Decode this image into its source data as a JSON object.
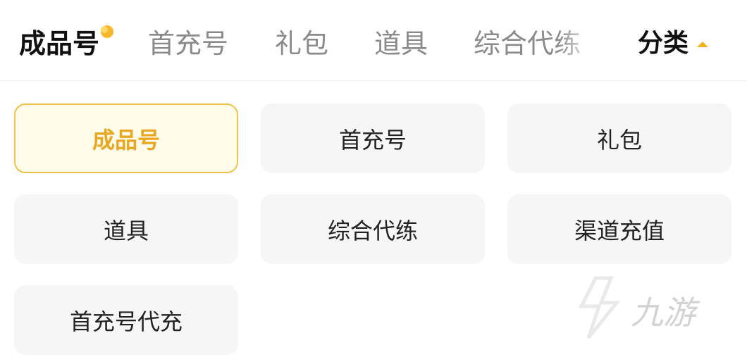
{
  "tabs": [
    {
      "label": "成品号",
      "active": true
    },
    {
      "label": "首充号",
      "active": false
    },
    {
      "label": "礼包",
      "active": false
    },
    {
      "label": "道具",
      "active": false
    },
    {
      "label": "综合代练",
      "active": false
    }
  ],
  "category_toggle": {
    "label": "分类",
    "icon": "caret-up-icon"
  },
  "categories": [
    {
      "label": "成品号",
      "selected": true
    },
    {
      "label": "首充号",
      "selected": false
    },
    {
      "label": "礼包",
      "selected": false
    },
    {
      "label": "道具",
      "selected": false
    },
    {
      "label": "综合代练",
      "selected": false
    },
    {
      "label": "渠道充值",
      "selected": false
    },
    {
      "label": "首充号代充",
      "selected": false
    }
  ],
  "watermark": {
    "text": "九游"
  },
  "colors": {
    "accent": "#f2b21f",
    "selected_text": "#e9a621",
    "selected_bg": "#fffbeb",
    "cell_bg": "#f6f6f6"
  }
}
